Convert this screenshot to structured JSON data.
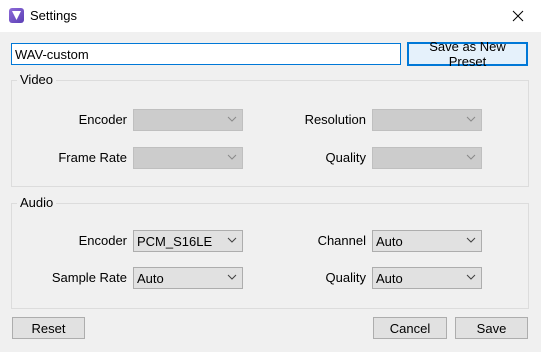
{
  "window": {
    "title": "Settings"
  },
  "preset": {
    "name_value": "WAV-custom",
    "save_button": "Save as New Preset"
  },
  "video": {
    "group_label": "Video",
    "encoder_label": "Encoder",
    "resolution_label": "Resolution",
    "frame_rate_label": "Frame Rate",
    "quality_label": "Quality",
    "encoder_value": "",
    "resolution_value": "",
    "frame_rate_value": "",
    "quality_value": ""
  },
  "audio": {
    "group_label": "Audio",
    "encoder_label": "Encoder",
    "encoder_value": "PCM_S16LE",
    "channel_label": "Channel",
    "channel_value": "Auto",
    "sample_rate_label": "Sample Rate",
    "sample_rate_value": "Auto",
    "quality_label": "Quality",
    "quality_value": "Auto"
  },
  "footer": {
    "reset_label": "Reset",
    "cancel_label": "Cancel",
    "save_label": "Save"
  },
  "colors": {
    "focus_accent": "#0078d7",
    "dialog_bg": "#f0f0f0",
    "app_icon": "#6f4fc8"
  },
  "icons": [
    "app-icon",
    "close-icon",
    "chevron-down-icon"
  ]
}
